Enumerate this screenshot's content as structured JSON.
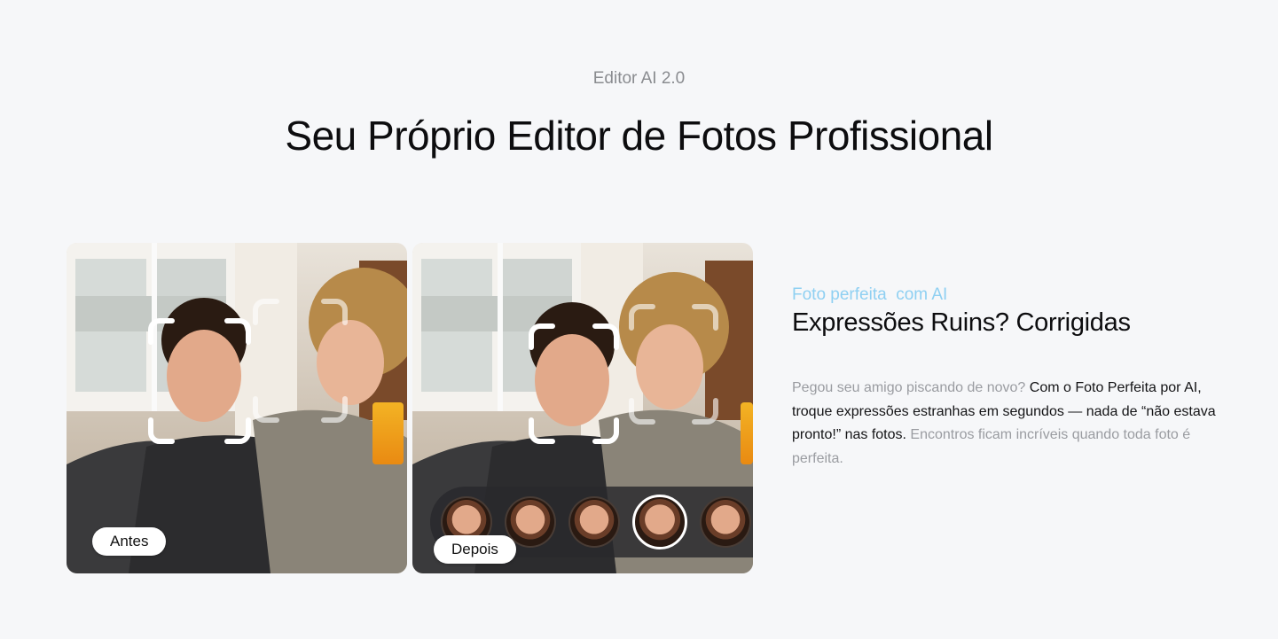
{
  "section": {
    "eyebrow": "Editor AI 2.0",
    "headline": "Seu Próprio Editor de Fotos Profissional"
  },
  "comparison": {
    "before_label": "Antes",
    "after_label": "Depois",
    "face_options_count": 5,
    "selected_face_index": 3
  },
  "feature": {
    "tag": "Foto perfeita  com AI",
    "title": "Expressões Ruins? Corrigidas",
    "body_intro": "Pegou seu amigo piscando de novo?",
    "body_highlight": "Com o Foto Perfeita por AI, troque expressões estranhas em segundos — nada de “não estava pronto!” nas fotos.",
    "body_outro": "Encontros ficam incríveis quando toda foto é perfeita."
  },
  "colors": {
    "background": "#f6f7f9",
    "accent_tag": "#8fd0f2",
    "muted_text": "#9a9ca1"
  }
}
